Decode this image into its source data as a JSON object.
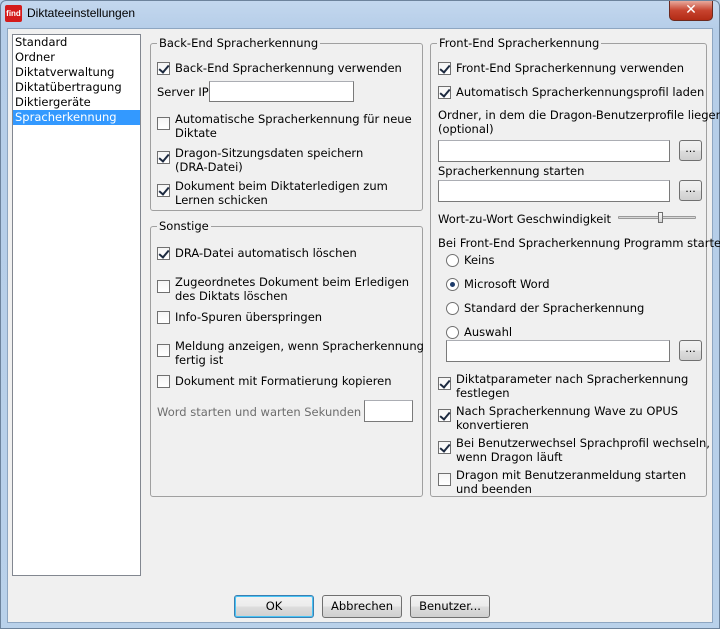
{
  "window": {
    "title": "Diktateeinstellungen",
    "app_icon_text": "find",
    "close_glyph": "✕"
  },
  "nav": {
    "items": [
      {
        "label": "Standard",
        "selected": false
      },
      {
        "label": "Ordner",
        "selected": false
      },
      {
        "label": "Diktatverwaltung",
        "selected": false
      },
      {
        "label": "Diktatübertragung",
        "selected": false
      },
      {
        "label": "Diktiergeräte",
        "selected": false
      },
      {
        "label": "Spracherkennung",
        "selected": true
      }
    ]
  },
  "backend": {
    "title": "Back-End Spracherkennung",
    "use_backend": {
      "label": "Back-End Spracherkennung verwenden",
      "checked": true
    },
    "server_ip_label": "Server IP",
    "server_ip_value": "",
    "auto_recognition": {
      "label1": "Automatische Spracherkennung für neue",
      "label2": "Diktate",
      "checked": false
    },
    "save_session": {
      "label1": "Dragon-Sitzungsdaten speichern",
      "label2": "(DRA-Datei)",
      "checked": true
    },
    "send_document": {
      "label1": "Dokument beim Diktaterledigen zum",
      "label2": "Lernen schicken",
      "checked": true
    }
  },
  "other": {
    "title": "Sonstige",
    "delete_dra": {
      "label": "DRA-Datei automatisch löschen",
      "checked": true
    },
    "delete_doc": {
      "label1": "Zugeordnetes Dokument beim Erledigen",
      "label2": "des Diktats löschen",
      "checked": false
    },
    "skip_info": {
      "label": "Info-Spuren überspringen",
      "checked": false
    },
    "show_msg": {
      "label1": "Meldung anzeigen, wenn Spracherkennung",
      "label2": "fertig ist",
      "checked": false
    },
    "copy_format": {
      "label": "Dokument mit Formatierung kopieren",
      "checked": false
    },
    "word_wait_label": "Word starten und warten Sekunden",
    "word_wait_value": ""
  },
  "frontend": {
    "title": "Front-End Spracherkennung",
    "use_frontend": {
      "label": "Front-End Spracherkennung verwenden",
      "checked": true
    },
    "auto_profile": {
      "label": "Automatisch Spracherkennungsprofil laden",
      "checked": true
    },
    "folder_label1": "Ordner, in dem die Dragon-Benutzerprofile liegen",
    "folder_label2": "(optional)",
    "folder_value": "",
    "start_label": "Spracherkennung starten",
    "start_value": "",
    "speed_label": "Wort-zu-Wort Geschwindigkeit",
    "speed_level": 0.55,
    "program_label": "Bei Front-End Spracherkennung Programm starten",
    "programs": [
      {
        "label": "Keins",
        "checked": false
      },
      {
        "label": "Microsoft Word",
        "checked": true
      },
      {
        "label": "Standard der Spracherkennung",
        "checked": false
      },
      {
        "label": "Auswahl",
        "checked": false
      }
    ],
    "selection_value": "",
    "browse_label": "...",
    "set_params": {
      "label1": "Diktatparameter nach Spracherkennung",
      "label2": "festlegen",
      "checked": true
    },
    "convert_wave": {
      "label1": "Nach Spracherkennung Wave zu OPUS",
      "label2": "konvertieren",
      "checked": true
    },
    "switch_profile": {
      "label1": "Bei Benutzerwechsel Sprachprofil wechseln,",
      "label2": "wenn Dragon läuft",
      "checked": true
    },
    "dragon_login": {
      "label1": "Dragon mit Benutzeranmeldung starten",
      "label2": "und beenden",
      "checked": false
    }
  },
  "buttons": {
    "ok": "OK",
    "cancel": "Abbrechen",
    "user": "Benutzer..."
  }
}
